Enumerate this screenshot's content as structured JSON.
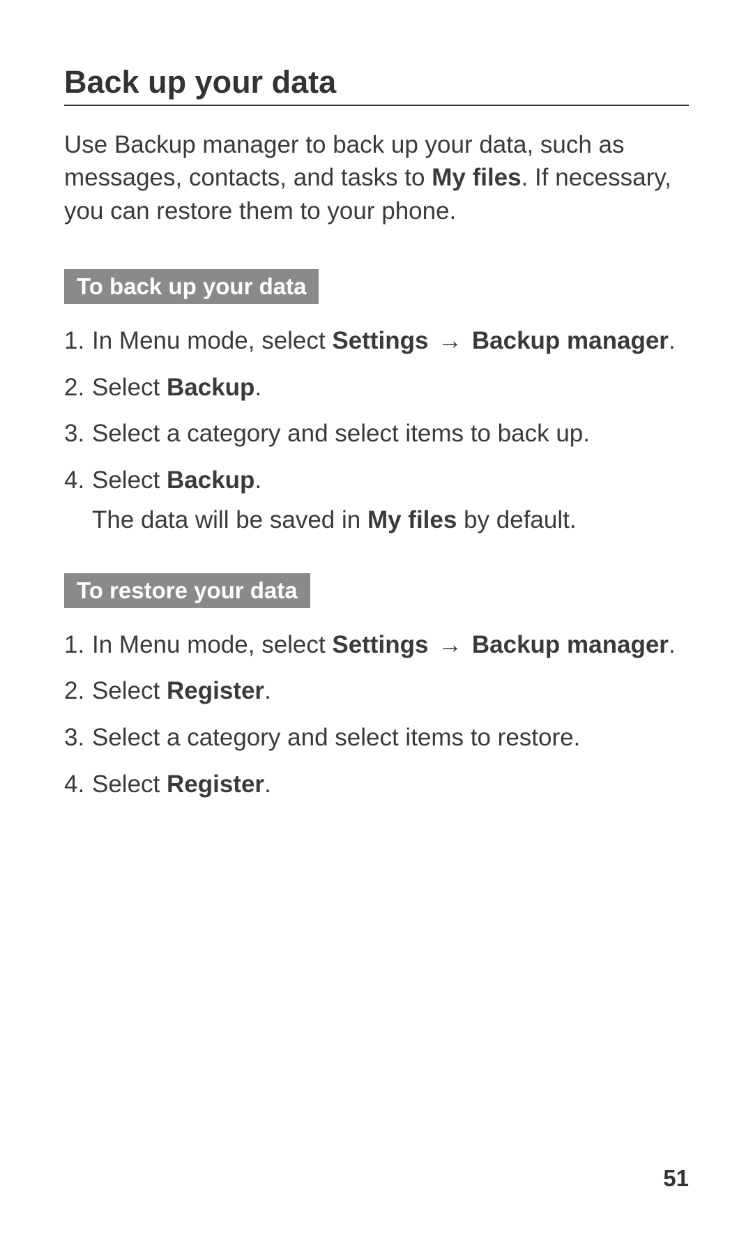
{
  "title": "Back up your data",
  "intro_pre": "Use Backup manager to back up your data, such as messages, contacts, and tasks to ",
  "intro_bold": "My files",
  "intro_post": ". If necessary, you can restore them to your phone.",
  "section1": {
    "heading": "To back up your data",
    "steps": [
      {
        "num": "1.",
        "pre": "In Menu mode, select ",
        "b1": "Settings",
        "arrow": " → ",
        "b2": "Backup manager",
        "post": "."
      },
      {
        "num": "2.",
        "pre": "Select ",
        "b1": "Backup",
        "post": "."
      },
      {
        "num": "3.",
        "text": "Select a category and select items to back up."
      },
      {
        "num": "4.",
        "pre": "Select ",
        "b1": "Backup",
        "post": ".",
        "note_pre": "The data will be saved in ",
        "note_b": "My files",
        "note_post": " by default."
      }
    ]
  },
  "section2": {
    "heading": "To restore your data",
    "steps": [
      {
        "num": "1.",
        "pre": "In Menu mode, select ",
        "b1": "Settings",
        "arrow": " → ",
        "b2": "Backup manager",
        "post": "."
      },
      {
        "num": "2.",
        "pre": "Select ",
        "b1": "Register",
        "post": "."
      },
      {
        "num": "3.",
        "text": "Select a category and select items to restore."
      },
      {
        "num": "4.",
        "pre": "Select ",
        "b1": "Register",
        "post": "."
      }
    ]
  },
  "page_number": "51"
}
